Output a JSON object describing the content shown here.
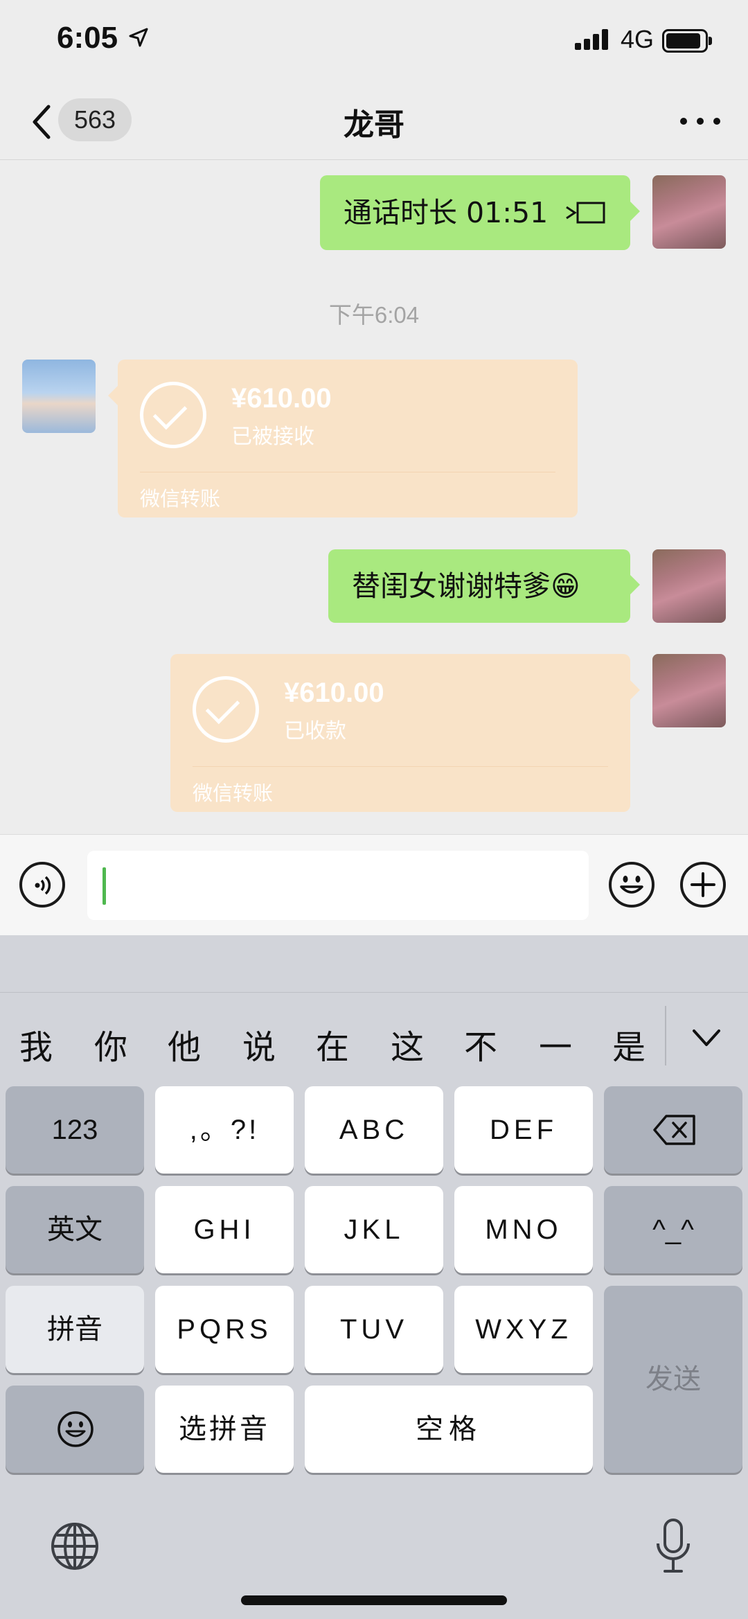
{
  "status_bar": {
    "time": "6:05",
    "network": "4G"
  },
  "nav": {
    "unread_count": "563",
    "title": "龙哥"
  },
  "messages": {
    "call": {
      "text": "通话时长 01:51"
    },
    "timestamp": "下午6:04",
    "transfer_received": {
      "amount": "¥610.00",
      "status": "已被接收",
      "label": "微信转账"
    },
    "text_reply": {
      "text": "替闺女谢谢特爹😁"
    },
    "transfer_sent": {
      "amount": "¥610.00",
      "status": "已收款",
      "label": "微信转账"
    }
  },
  "keyboard": {
    "candidates": [
      "我",
      "你",
      "他",
      "说",
      "在",
      "这",
      "不",
      "一",
      "是"
    ],
    "rows": {
      "r1": [
        "123",
        ",。?!",
        "ABC",
        "DEF"
      ],
      "r2": [
        "英文",
        "GHI",
        "JKL",
        "MNO",
        "^_^"
      ],
      "r3": [
        "拼音",
        "PQRS",
        "TUV",
        "WXYZ"
      ],
      "r4": [
        "选拼音",
        "空格"
      ],
      "send": "发送"
    }
  },
  "icons": {
    "back": "chevron-left-icon",
    "more": "ellipsis-icon",
    "voice": "voice-icon",
    "emoji": "emoji-icon",
    "add": "plus-icon",
    "backspace": "backspace-icon",
    "globe": "globe-icon",
    "mic": "microphone-icon",
    "call": "video-call-icon"
  },
  "colors": {
    "bubble_green": "#a9e97f",
    "transfer_orange": "#f9e3c8",
    "background": "#ededed",
    "caret": "#4fb84f"
  }
}
